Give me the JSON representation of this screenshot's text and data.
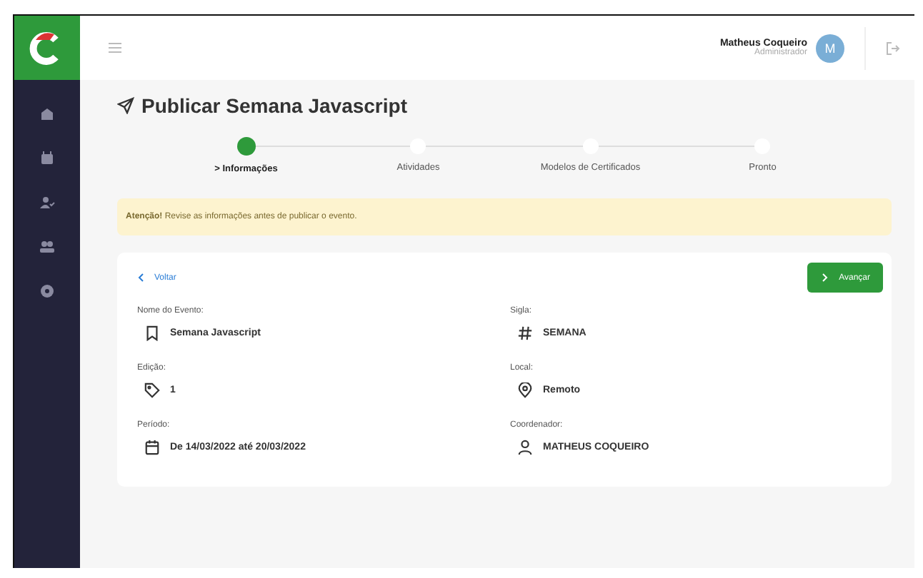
{
  "user": {
    "name": "Matheus Coqueiro",
    "role": "Administrador",
    "initial": "M"
  },
  "sidebar": {
    "items": [
      {
        "kind": "home"
      },
      {
        "kind": "calendar"
      },
      {
        "kind": "user-check"
      },
      {
        "kind": "users"
      },
      {
        "kind": "settings"
      }
    ]
  },
  "page": {
    "title": "Publicar Semana Javascript"
  },
  "steps": [
    {
      "label": "> Informações",
      "selected": true
    },
    {
      "label": "Atividades",
      "selected": false
    },
    {
      "label": "Modelos de Certificados",
      "selected": false
    },
    {
      "label": "Pronto",
      "selected": false
    }
  ],
  "alert": {
    "text": "**Atenção!** Revise as informações antes de publicar o evento."
  },
  "card": {
    "back": "Voltar",
    "next": "Avançar",
    "fields": [
      {
        "label": "Nome do Evento:",
        "value": "Semana Javascript",
        "kind": "bookmark"
      },
      {
        "label": "Sigla:",
        "value": "SEMANA",
        "kind": "hash"
      },
      {
        "label": "Edição:",
        "value": "1",
        "kind": "tag"
      },
      {
        "label": "Local:",
        "value": "Remoto",
        "kind": "pin"
      },
      {
        "label": "Período:",
        "value": "De 14/03/2022 até 20/03/2022",
        "kind": "calendar"
      },
      {
        "label": "Coordenador:",
        "value": "MATHEUS COQUEIRO",
        "kind": "user"
      }
    ]
  }
}
